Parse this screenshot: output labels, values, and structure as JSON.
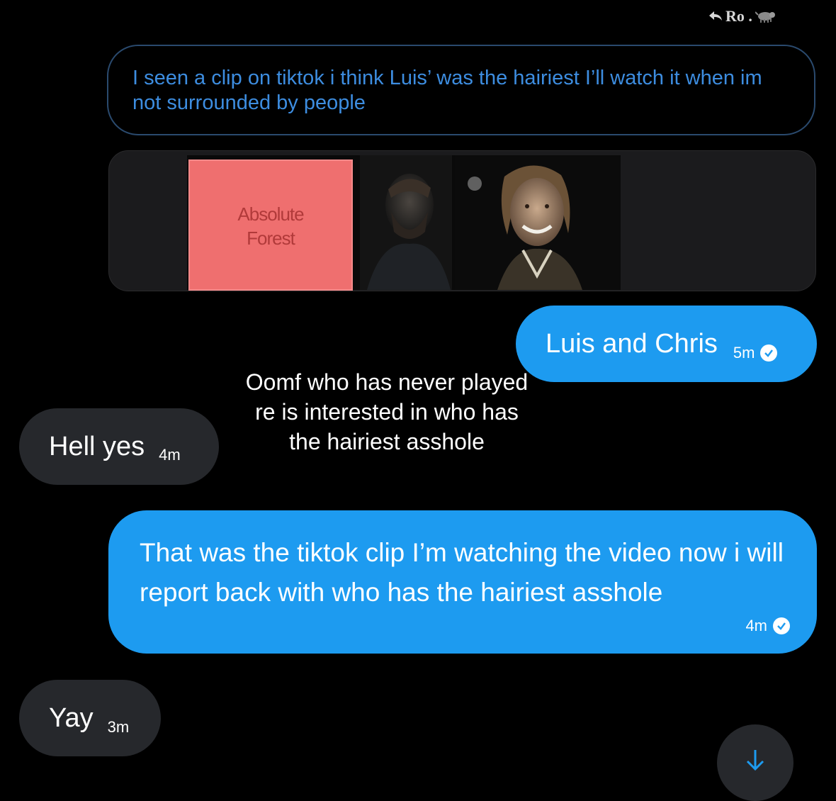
{
  "reply_header": {
    "name": "Ro .",
    "reply_icon": "reply-arrow-icon",
    "avatar_icon": "animal-avatar-icon"
  },
  "quoted_message": {
    "text": "I seen a clip on tiktok i think Luis’ was the hairiest I’ll watch it when im not surrounded by people"
  },
  "media": {
    "card_text_line1": "Absolute",
    "card_text_line2": "Forest"
  },
  "messages": [
    {
      "id": "luis_and_chris",
      "text": "Luis and Chris",
      "time": "5m",
      "sender": "self",
      "status": "read"
    },
    {
      "id": "hell_yes",
      "text": "Hell yes",
      "time": "4m",
      "sender": "other"
    },
    {
      "id": "tiktok_clip",
      "text": "That was the tiktok clip I’m watching the video now i will report back with who has the hairiest asshole",
      "time": "4m",
      "sender": "self",
      "status": "read"
    },
    {
      "id": "yay",
      "text": "Yay",
      "time": "3m",
      "sender": "other"
    }
  ],
  "caption_overlay": {
    "text": "Oomf who has never played re is interested in who has the hairiest asshole"
  },
  "scroll_button": {
    "icon": "arrow-down-icon"
  },
  "colors": {
    "accent_blue": "#1d9bf0",
    "dark_bubble": "#26282c",
    "quoted_text": "#3d8de0",
    "background": "#000000"
  }
}
